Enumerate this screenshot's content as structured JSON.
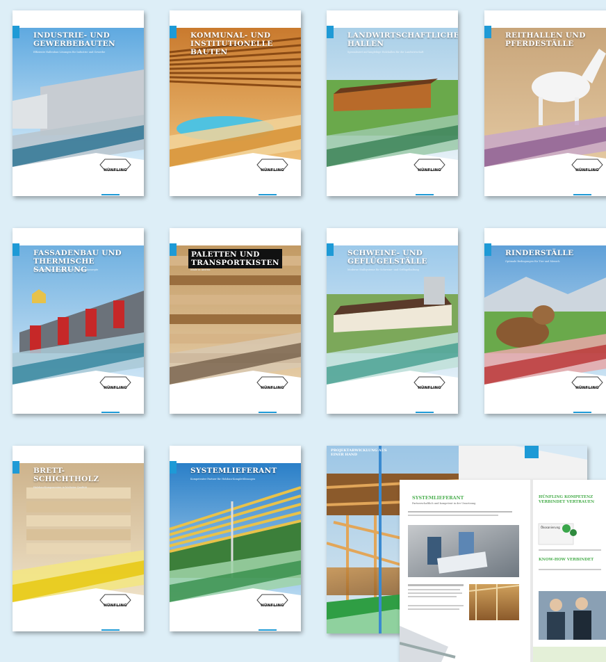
{
  "brand": "HÜNFLING",
  "colors": {
    "accent": "#1e9ad6",
    "background": "#ddeef7"
  },
  "covers": [
    {
      "title_line1": "INDUSTRIE- UND",
      "title_line2": "GEWERBEBAUTEN",
      "subtitle": "Effiziente Hallenbau-Lösungen für Industrie und Gewerbe"
    },
    {
      "title_line1": "KOMMUNAL- UND",
      "title_line2": "INSTITUTIONELLE BAUTEN",
      "subtitle": ""
    },
    {
      "title_line1": "LANDWIRTSCHAFTLICHE",
      "title_line2": "HALLEN",
      "subtitle": "Spezialisiert auf langlebige Holzhallen für die Landwirtschaft"
    },
    {
      "title_line1": "REITHALLEN UND",
      "title_line2": "PFERDESTÄLLE",
      "subtitle": ""
    },
    {
      "title_line1": "FASSADENBAU UND",
      "title_line2": "THERMISCHE SANIERUNG",
      "subtitle": "Energieeffiziente Fassaden und Sanierungskonzepte"
    },
    {
      "title_line1": "PALETTEN UND",
      "title_line2": "TRANSPORTKISTEN",
      "subtitle": "Made in Austria"
    },
    {
      "title_line1": "SCHWEINE- UND",
      "title_line2": "GEFLÜGELSTÄLLE",
      "subtitle": "Moderne Stallsysteme für Schweine- und Geflügelhaltung"
    },
    {
      "title_line1": "RINDERSTÄLLE",
      "title_line2": "",
      "subtitle": "Optimale Bedingungen für Tier und Mensch"
    },
    {
      "title_line1": "BRETT-",
      "title_line2": "SCHICHTHOLZ",
      "subtitle": "Holzbau-Komponenten in höchster Qualität"
    },
    {
      "title_line1": "SYSTEMLIEFERANT",
      "title_line2": "",
      "subtitle": "Kompetenter Partner für Holzbau-Komplettlösungen"
    }
  ],
  "spread": {
    "back_title_line1": "PROJEKTABWICKLUNG AUS",
    "back_title_line2": "EINER HAND",
    "left_heading": "SYSTEMLIEFERANT",
    "left_sub": "Partnerschaftlich und kompetent in der Umsetzung",
    "right_heading_line1": "HÜNFLING KOMPETENZ",
    "right_heading_line2": "VERBINDET VERTRAUEN",
    "right_section": "KNOW-HOW VERBINDET",
    "badge": "Ökosanierung"
  }
}
